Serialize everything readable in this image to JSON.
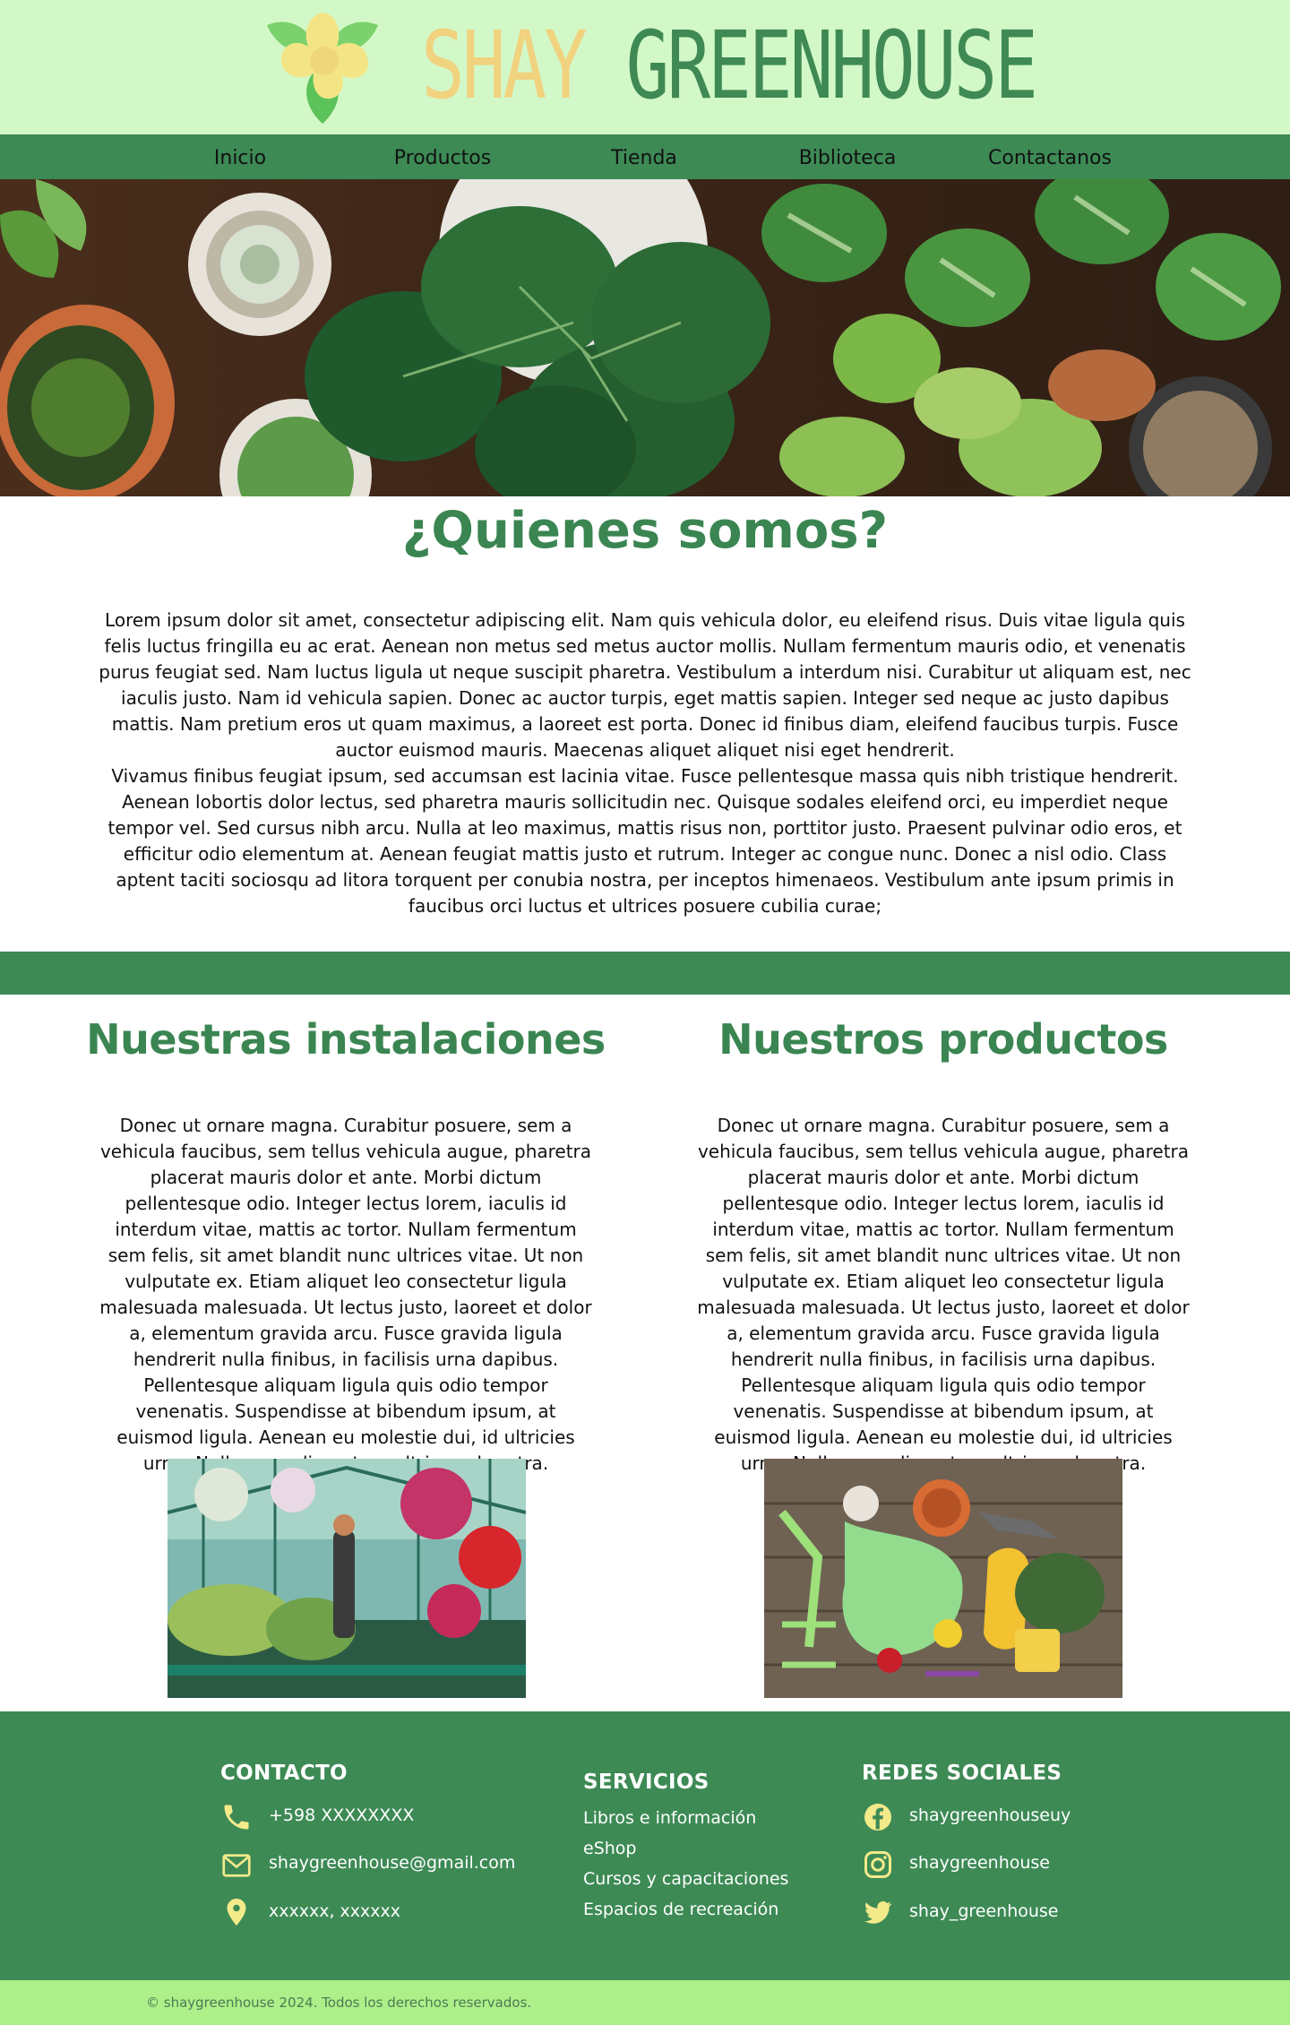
{
  "site": {
    "brand_part1": "SHAY",
    "brand_part2": "GREENHOUSE"
  },
  "nav": {
    "items": [
      "Inicio",
      "Productos",
      "Tienda",
      "Biblioteca",
      "Contactanos"
    ]
  },
  "about": {
    "title": "¿Quienes somos?",
    "paragraph1": "Lorem ipsum dolor sit amet, consectetur adipiscing elit. Nam quis vehicula dolor, eu eleifend risus. Duis vitae ligula quis felis luctus fringilla eu ac erat. Aenean non metus sed metus auctor mollis. Nullam fermentum mauris odio, et venenatis purus feugiat sed. Nam luctus ligula ut neque suscipit pharetra. Vestibulum a interdum nisi. Curabitur ut aliquam est, nec iaculis justo. Nam id vehicula sapien. Donec ac auctor turpis, eget mattis sapien. Integer sed neque ac justo dapibus mattis. Nam pretium eros ut quam maximus, a laoreet est porta. Donec id finibus diam, eleifend faucibus turpis. Fusce auctor euismod mauris. Maecenas aliquet aliquet nisi eget hendrerit.",
    "paragraph2": "Vivamus finibus feugiat ipsum, sed accumsan est lacinia vitae. Fusce pellentesque massa quis nibh tristique hendrerit. Aenean lobortis dolor lectus, sed pharetra mauris sollicitudin nec. Quisque sodales eleifend orci, eu imperdiet neque tempor vel. Sed cursus nibh arcu. Nulla at leo maximus, mattis risus non, porttitor justo. Praesent pulvinar odio eros, et efficitur odio elementum at. Aenean feugiat mattis justo et rutrum. Integer ac congue nunc. Donec a nisl odio. Class aptent taciti sociosqu ad litora torquent per conubia nostra, per inceptos himenaeos. Vestibulum ante ipsum primis in faucibus orci luctus et ultrices posuere cubilia curae;"
  },
  "sections": [
    {
      "title": "Nuestras instalaciones",
      "text": "Donec ut ornare magna. Curabitur posuere, sem a vehicula faucibus, sem tellus vehicula augue, pharetra placerat mauris dolor et ante. Morbi dictum pellentesque odio. Integer lectus lorem, iaculis id interdum vitae, mattis ac tortor. Nullam fermentum sem felis, sit amet blandit nunc ultrices vitae. Ut non vulputate ex. Etiam aliquet leo consectetur ligula malesuada malesuada. Ut lectus justo, laoreet et dolor a, elementum gravida arcu. Fusce gravida ligula hendrerit nulla finibus, in facilisis urna dapibus. Pellentesque aliquam ligula quis odio tempor venenatis. Suspendisse at bibendum ipsum, at euismod ligula. Aenean eu molestie dui, id ultricies urna. Nullam condimentum ultrices pharetra."
    },
    {
      "title": "Nuestros productos",
      "text": "Donec ut ornare magna. Curabitur posuere, sem a vehicula faucibus, sem tellus vehicula augue, pharetra placerat mauris dolor et ante. Morbi dictum pellentesque odio. Integer lectus lorem, iaculis id interdum vitae, mattis ac tortor. Nullam fermentum sem felis, sit amet blandit nunc ultrices vitae. Ut non vulputate ex. Etiam aliquet leo consectetur ligula malesuada malesuada. Ut lectus justo, laoreet et dolor a, elementum gravida arcu. Fusce gravida ligula hendrerit nulla finibus, in facilisis urna dapibus. Pellentesque aliquam ligula quis odio tempor venenatis. Suspendisse at bibendum ipsum, at euismod ligula. Aenean eu molestie dui, id ultricies urna. Nullam condimentum ultrices pharetra."
    }
  ],
  "footer": {
    "contact": {
      "title": "CONTACTO",
      "phone": "+598 XXXXXXXX",
      "email": "shaygreenhouse@gmail.com",
      "address": "xxxxxx, xxxxxx"
    },
    "services": {
      "title": "SERVICIOS",
      "items": [
        "Libros e información",
        "eShop",
        "Cursos y capacitaciones",
        "Espacios de recreación"
      ]
    },
    "social": {
      "title": "REDES SOCIALES",
      "facebook": "shaygreenhouseuy",
      "instagram": "shaygreenhouse",
      "twitter": "shay_greenhouse"
    },
    "copyright": "© shaygreenhouse 2024. Todos los derechos reservados."
  },
  "icons": {
    "logo": "flower-logo-icon",
    "phone": "phone-icon",
    "email": "mail-icon",
    "location": "location-pin-icon",
    "facebook": "facebook-icon",
    "instagram": "instagram-icon",
    "twitter": "twitter-icon"
  },
  "colors": {
    "header_bg": "#d3f8c8",
    "primary_green": "#3d8a55",
    "accent_yellow": "#f1d27f",
    "icon_yellow": "#f3ea8a",
    "copyright_bg": "#adf089"
  }
}
